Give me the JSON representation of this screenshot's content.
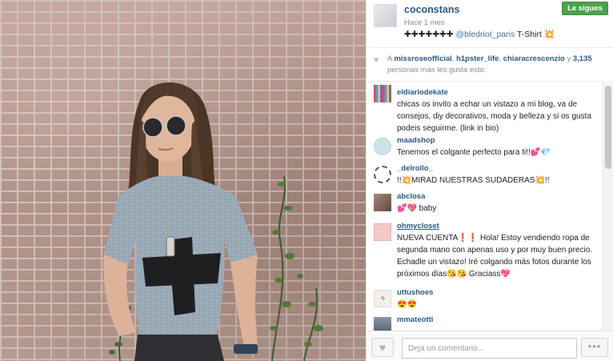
{
  "post": {
    "username": "coconstans",
    "time": "Hace 1 mes",
    "follow_label": "Le sigues",
    "caption_symbols": "✚✚✚✚✚✚✚",
    "caption_mention": "@bledriot_paris",
    "caption_text": "T-Shirt",
    "caption_emoji": "💥"
  },
  "likes": {
    "prefix": "A",
    "likers": [
      "missroseofficial",
      "h1pster_life",
      "chiaracrescenzio"
    ],
    "separator": ",",
    "connector": "y",
    "count": "3,135",
    "suffix": "personas más les gusta esto."
  },
  "comments": [
    {
      "user": "eldiariodekate",
      "text": "chicas os invito a echar un vistazo a mi blog, va de consejos, diy decorativos, moda y belleza y si os gusta podeis seguirme. (link in bio)",
      "avatar_color": "#d8c7b6"
    },
    {
      "user": "maadshop",
      "text": "Tenemos el colgante perfecto para ti!!💕💎",
      "avatar_color": "#cde3ea"
    },
    {
      "user": "_delrollo_",
      "text": "!!💥MIRAD NUESTRAS SUDADERAS💥!!",
      "avatar_color": "#ffffff"
    },
    {
      "user": "abclosa",
      "text": "💕💖 baby",
      "avatar_color": "#8a6f63"
    },
    {
      "user": "ohmycloset",
      "text": "NUEVA CUENTA❗️❗️ Hola! Estoy vendiendo ropa de segunda mano con apenas uso y por muy buen precio. Echadle un vistazo! Iré colgando más fotos durante los próximos días😘😘 Graciass💖",
      "avatar_color": "#f6c9c9"
    },
    {
      "user": "uttushoes",
      "text": "😍😍",
      "avatar_color": "#f2eee8"
    },
    {
      "user": "mmateotti",
      "text": "",
      "avatar_color": "#5c6a7a"
    }
  ],
  "footer": {
    "comment_placeholder": "Deja un comentario...",
    "like_icon": "heart-icon",
    "more_icon": "more-options-icon"
  },
  "colors": {
    "link": "#2b5a83",
    "follow_green": "#4ea24b",
    "brick": "#b4968c"
  }
}
